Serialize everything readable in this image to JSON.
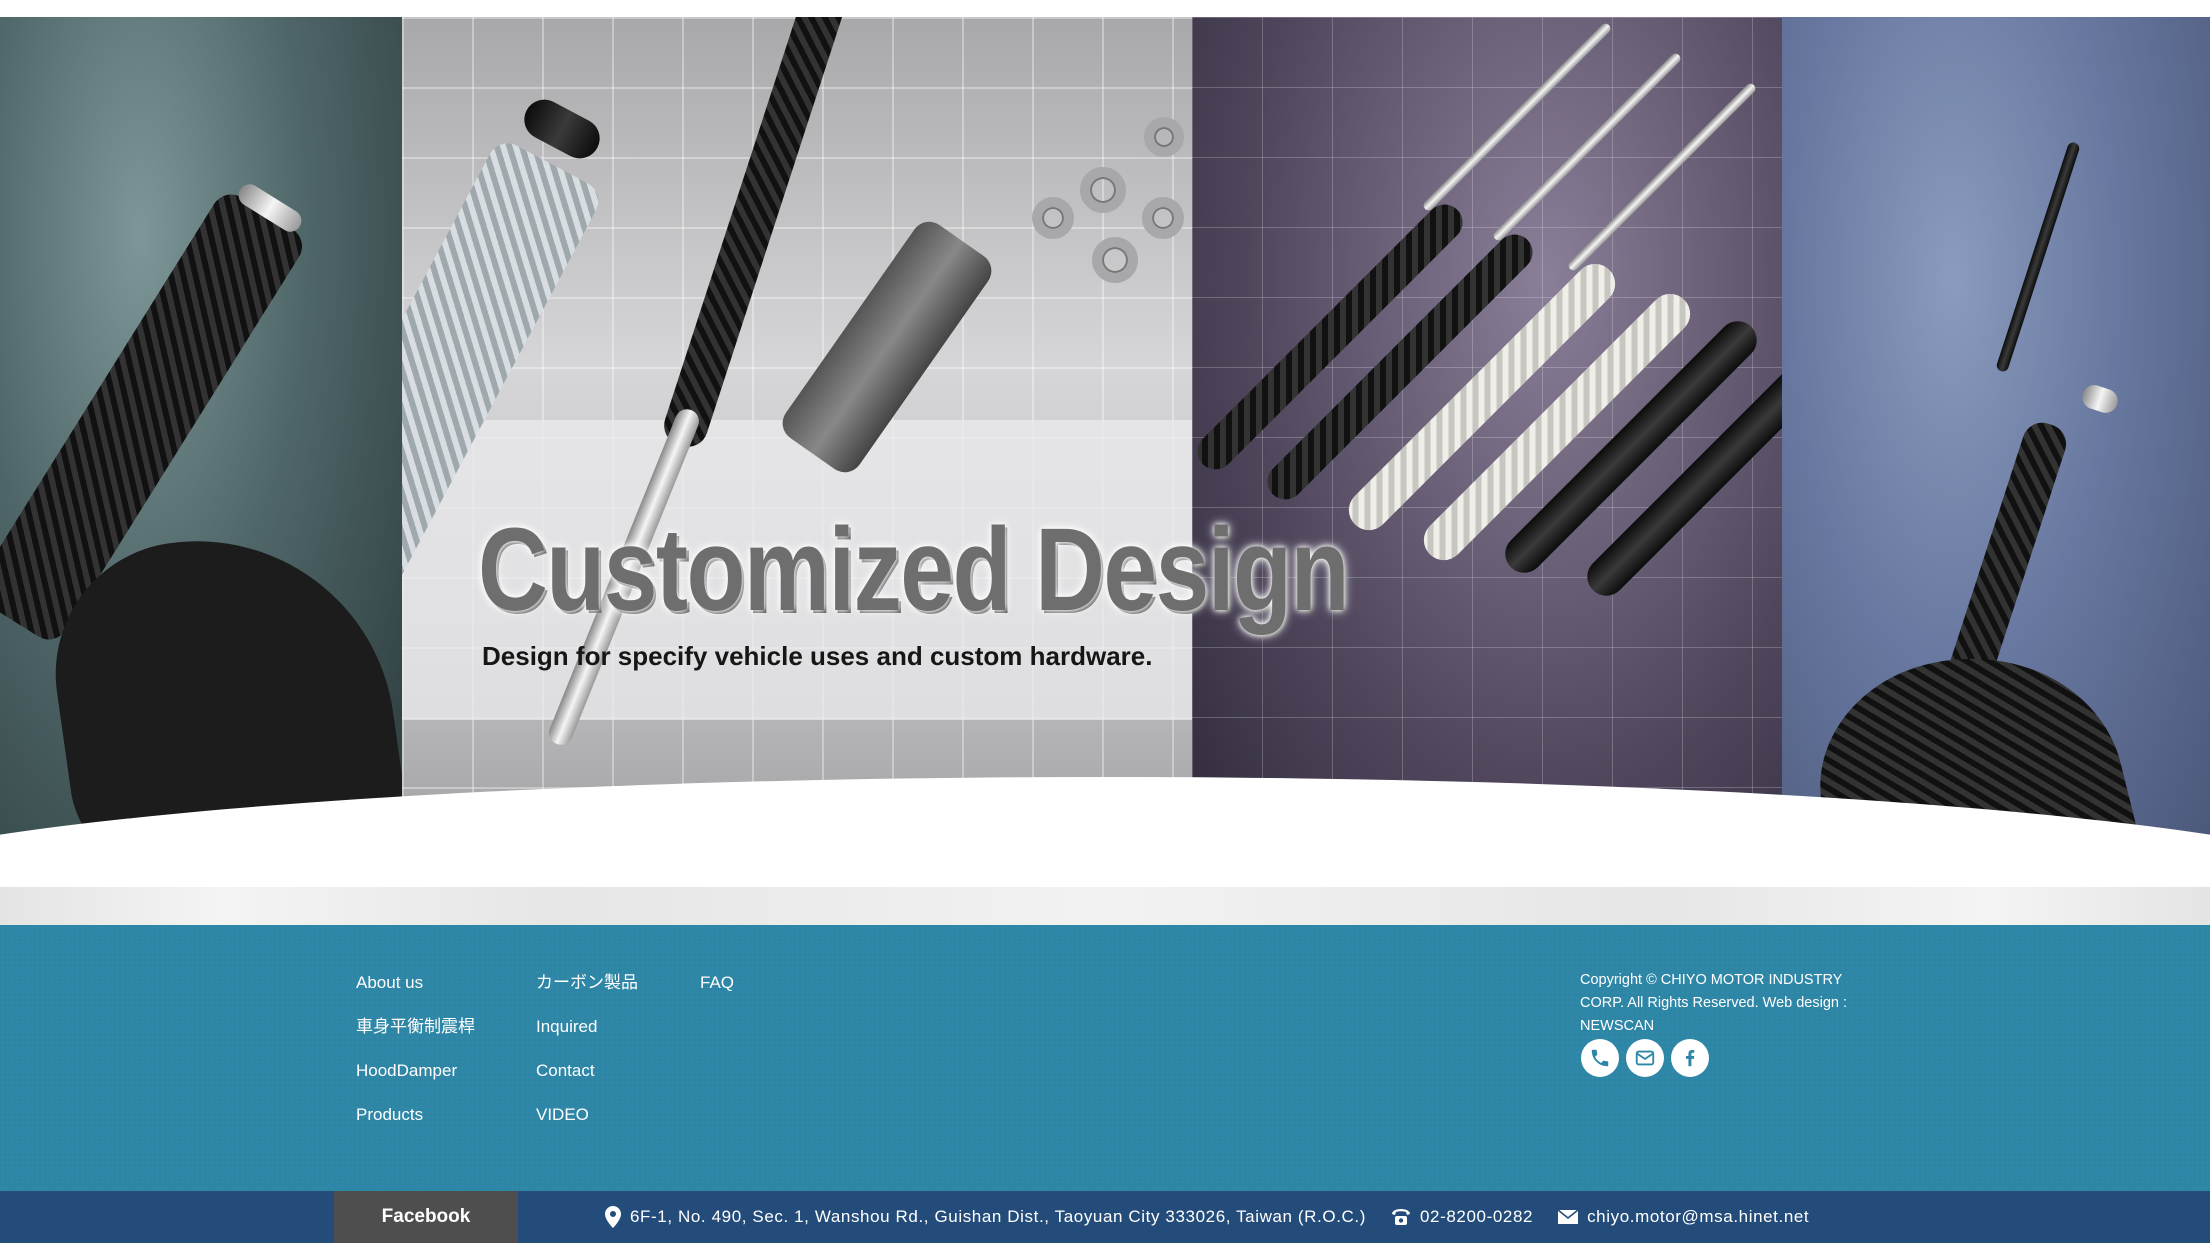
{
  "hero": {
    "title": "Customized Design",
    "subtitle": "Design for specify vehicle uses and custom hardware."
  },
  "footer": {
    "nav_col1": [
      "About us",
      "車身平衡制震桿",
      "HoodDamper",
      "Products"
    ],
    "nav_col2": [
      "カーボン製品",
      "Inquired",
      "Contact",
      "VIDEO"
    ],
    "nav_col3": [
      "FAQ"
    ],
    "copyright": "Copyright © CHIYO MOTOR INDUSTRY CORP. All Rights Reserved. Web design : NEWSCAN",
    "social_icons": [
      "phone-icon",
      "mail-icon",
      "facebook-icon"
    ]
  },
  "bottom_bar": {
    "facebook_tab": "Facebook",
    "address": "6F-1, No. 490, Sec. 1, Wanshou Rd., Guishan Dist., Taoyuan City 333026, Taiwan (R.O.C.)",
    "phone": "02-8200-0282",
    "email": "chiyo.motor@msa.hinet.net"
  },
  "colors": {
    "footer_bg": "#2e86a6",
    "bottom_bar_bg": "#244c7a",
    "facebook_tab_bg": "#4e4e4e"
  }
}
